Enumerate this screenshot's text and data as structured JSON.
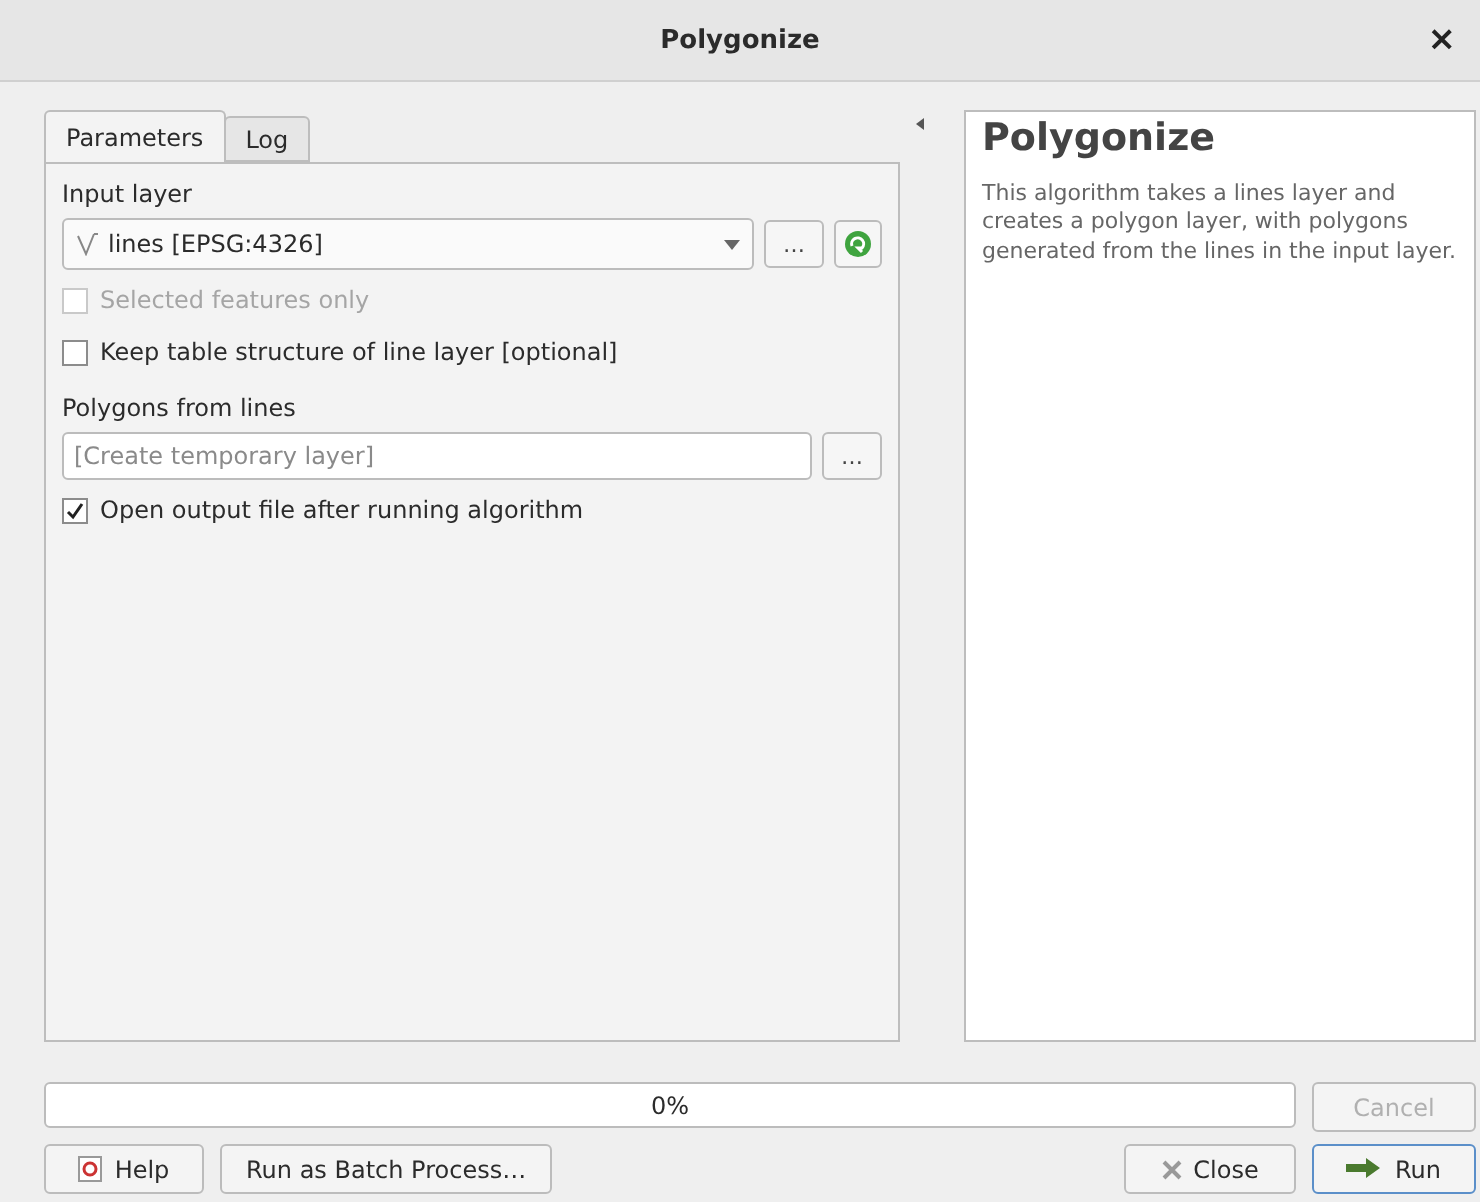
{
  "window": {
    "title": "Polygonize",
    "close": "×"
  },
  "tabs": [
    {
      "label": "Parameters",
      "selected": true
    },
    {
      "label": "Log",
      "selected": false
    }
  ],
  "parameters": [
    {
      "kind": "layer",
      "label": "Input layer",
      "value": "lines [EPSG:4326]",
      "browse": "…"
    },
    {
      "kind": "checkbox",
      "label": "Selected features only",
      "checked": false,
      "disabled": true
    },
    {
      "kind": "checkbox",
      "label": "Keep table structure of line layer [optional]",
      "checked": false,
      "disabled": false
    },
    {
      "kind": "output",
      "label": "Polygons from lines",
      "placeholder": "[Create temporary layer]",
      "browse": "…"
    },
    {
      "kind": "checkbox",
      "label": "Open output file after running algorithm",
      "checked": true,
      "disabled": false
    }
  ],
  "help": {
    "title": "Polygonize",
    "text": "This algorithm takes a lines layer and creates a polygon layer, with polygons generated from the lines in the input layer."
  },
  "progress": {
    "level": 0,
    "reading": "0%",
    "cancel": {
      "label": "Cancel",
      "disabled": true
    }
  },
  "buttons_left": [
    {
      "kind": "help",
      "label": "Help"
    },
    {
      "kind": "plain",
      "label": "Run as Batch Process…"
    }
  ],
  "buttons_right": [
    {
      "kind": "close",
      "label": "Close"
    },
    {
      "kind": "run",
      "label": "Run"
    }
  ]
}
